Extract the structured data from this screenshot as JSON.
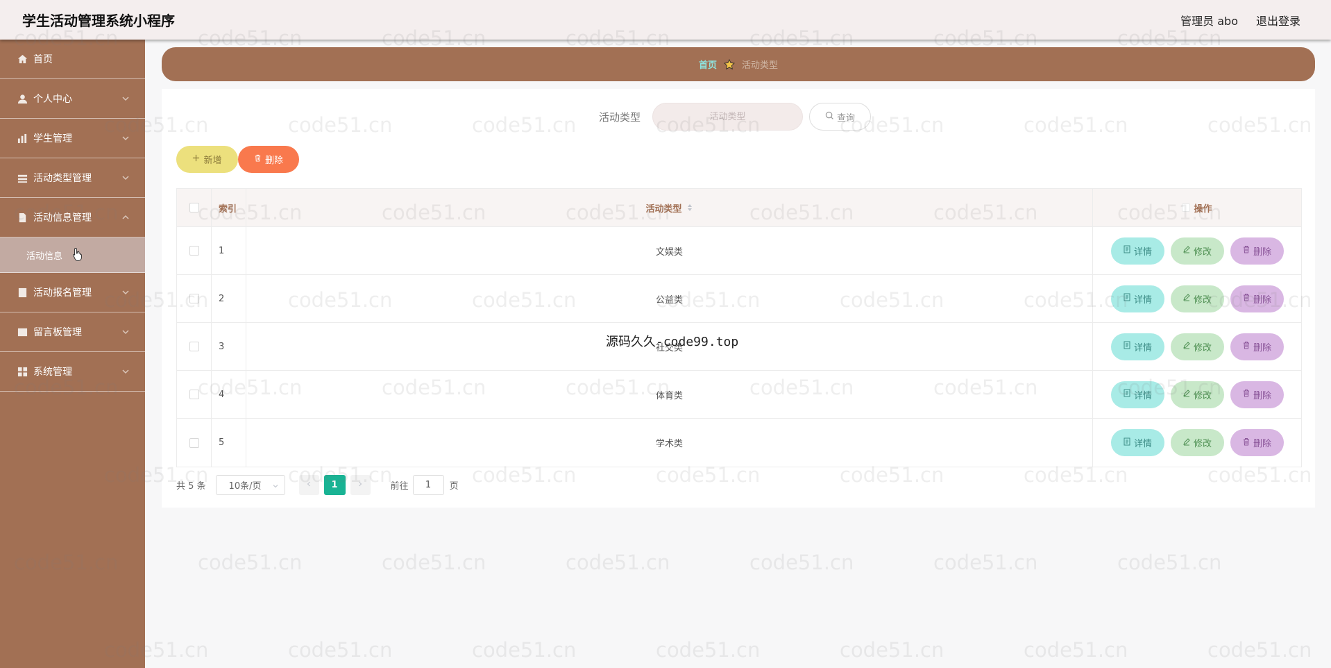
{
  "header": {
    "app_title": "学生活动管理系统小程序",
    "user_label": "管理员 abo",
    "logout_label": "退出登录"
  },
  "sidebar": {
    "items": [
      {
        "label": "首页",
        "icon": "home-icon",
        "has_chevron": false
      },
      {
        "label": "个人中心",
        "icon": "user-icon",
        "has_chevron": true
      },
      {
        "label": "学生管理",
        "icon": "chart-icon",
        "has_chevron": true
      },
      {
        "label": "活动类型管理",
        "icon": "layers-icon",
        "has_chevron": true
      },
      {
        "label": "活动信息管理",
        "icon": "file-icon",
        "has_chevron": true
      },
      {
        "label": "活动报名管理",
        "icon": "doc-icon",
        "has_chevron": true
      },
      {
        "label": "留言板管理",
        "icon": "grid-icon",
        "has_chevron": true
      },
      {
        "label": "系统管理",
        "icon": "apps-icon",
        "has_chevron": true
      }
    ],
    "active_sub": "活动信息"
  },
  "breadcrumb": {
    "home": "首页",
    "current": "活动类型"
  },
  "search": {
    "label": "活动类型",
    "placeholder": "活动类型",
    "button": "查询"
  },
  "actions": {
    "add": "新增",
    "delete": "删除"
  },
  "table": {
    "headers": {
      "index": "索引",
      "type": "活动类型",
      "ops": "操作"
    },
    "rows": [
      {
        "index": "1",
        "type": "文娱类"
      },
      {
        "index": "2",
        "type": "公益类"
      },
      {
        "index": "3",
        "type": "社交类"
      },
      {
        "index": "4",
        "type": "体育类"
      },
      {
        "index": "5",
        "type": "学术类"
      }
    ],
    "op_labels": {
      "detail": "详情",
      "edit": "修改",
      "delete": "删除"
    }
  },
  "pagination": {
    "total": "共 5 条",
    "page_size": "10条/页",
    "current_page": "1",
    "goto_label": "前往",
    "goto_value": "1",
    "page_suffix": "页"
  },
  "watermark": {
    "text": "code51.cn",
    "center_text": "源码久久-code99.top"
  },
  "colors": {
    "brand": "#a27054",
    "accent": "#19b394"
  }
}
